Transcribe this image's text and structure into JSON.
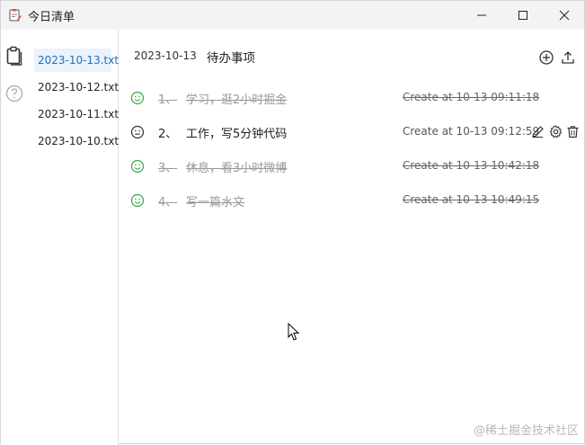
{
  "window": {
    "title": "今日清单"
  },
  "files": [
    {
      "name": "2023-10-13.txt",
      "active": true
    },
    {
      "name": "2023-10-12.txt",
      "active": false
    },
    {
      "name": "2023-10-11.txt",
      "active": false
    },
    {
      "name": "2023-10-10.txt",
      "active": false
    }
  ],
  "header": {
    "date": "2023-10-13",
    "title": "待办事项"
  },
  "tasks": [
    {
      "num": "1、",
      "text": "学习，逛2小时掘金",
      "time": "Create at 10-13 09:11:18",
      "done": true
    },
    {
      "num": "2、",
      "text": "工作，写5分钟代码",
      "time": "Create at 10-13 09:12:59",
      "done": false
    },
    {
      "num": "3、",
      "text": "休息，看3小时微博",
      "time": "Create at 10-13 10:42:18",
      "done": true
    },
    {
      "num": "4、",
      "text": "写一篇水文",
      "time": "Create at 10-13 10:49:15",
      "done": true
    }
  ],
  "watermark": "@稀土掘金技术社区",
  "colors": {
    "done_icon": "#3aa845",
    "pending_icon": "#333333",
    "active_file_bg": "#eaf3fb",
    "active_file_text": "#1f6fbf"
  },
  "icons": {
    "app": "clipboard-pen-icon",
    "rail_1": "clipboard-icon",
    "rail_2": "help-circle-icon",
    "add": "add-circle-icon",
    "export": "export-icon",
    "edit": "pencil-icon",
    "settings": "gear-icon",
    "delete": "trash-icon"
  }
}
